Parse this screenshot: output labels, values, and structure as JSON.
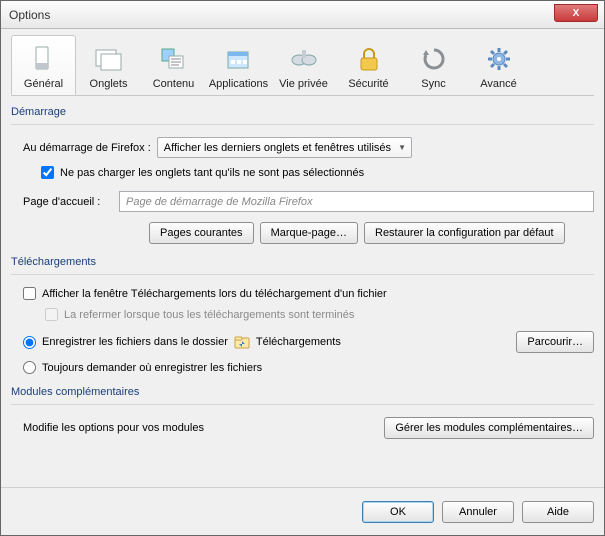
{
  "window": {
    "title": "Options",
    "close_label": "X"
  },
  "tabs": {
    "general": "Général",
    "onglets": "Onglets",
    "contenu": "Contenu",
    "applications": "Applications",
    "vieprivee": "Vie privée",
    "securite": "Sécurité",
    "sync": "Sync",
    "avance": "Avancé"
  },
  "startup": {
    "group": "Démarrage",
    "when_label": "Au démarrage de Firefox :",
    "when_value": "Afficher les derniers onglets et fenêtres utilisés",
    "dont_load": "Ne pas charger les onglets tant qu'ils ne sont pas sélectionnés",
    "homepage_label": "Page d'accueil :",
    "homepage_placeholder": "Page de démarrage de Mozilla Firefox",
    "btn_current": "Pages courantes",
    "btn_bookmark": "Marque-page…",
    "btn_restore": "Restaurer la configuration par défaut"
  },
  "downloads": {
    "group": "Téléchargements",
    "show_window": "Afficher la fenêtre Téléchargements lors du téléchargement d'un fichier",
    "close_when_done": "La refermer lorsque tous les téléchargements sont terminés",
    "save_in": "Enregistrer les fichiers dans le dossier",
    "folder_name": "Téléchargements",
    "browse": "Parcourir…",
    "always_ask": "Toujours demander où enregistrer les fichiers"
  },
  "addons": {
    "group": "Modules complémentaires",
    "desc": "Modifie les options pour vos modules",
    "manage": "Gérer les modules complémentaires…"
  },
  "buttons": {
    "ok": "OK",
    "cancel": "Annuler",
    "help": "Aide"
  }
}
